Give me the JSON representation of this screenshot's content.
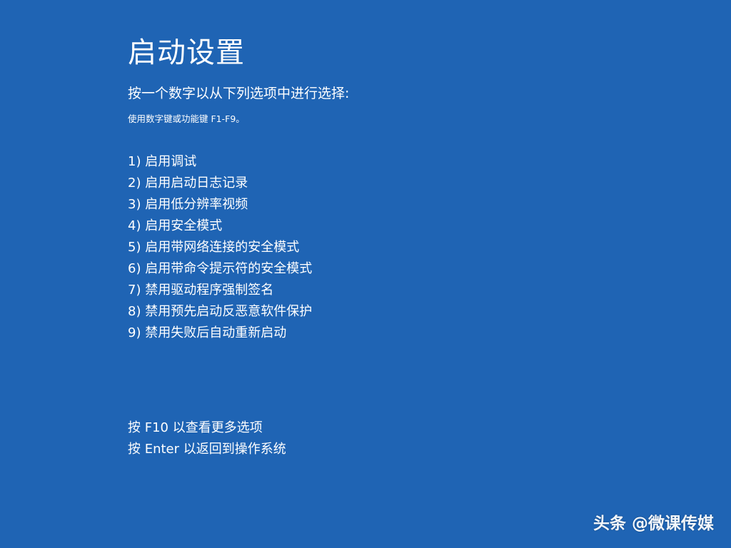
{
  "title": "启动设置",
  "subtitle": "按一个数字以从下列选项中进行选择:",
  "hint": "使用数字键或功能键 F1-F9。",
  "options": [
    "1) 启用调试",
    "2) 启用启动日志记录",
    "3) 启用低分辨率视频",
    "4) 启用安全模式",
    "5) 启用带网络连接的安全模式",
    "6) 启用带命令提示符的安全模式",
    "7) 禁用驱动程序强制签名",
    "8) 禁用预先启动反恶意软件保护",
    "9) 禁用失败后自动重新启动"
  ],
  "footer": {
    "more_options": "按 F10 以查看更多选项",
    "return_os": "按 Enter 以返回到操作系统"
  },
  "watermark": "头条 @微课传媒",
  "colors": {
    "background": "#1f64b4",
    "text": "#ffffff"
  }
}
